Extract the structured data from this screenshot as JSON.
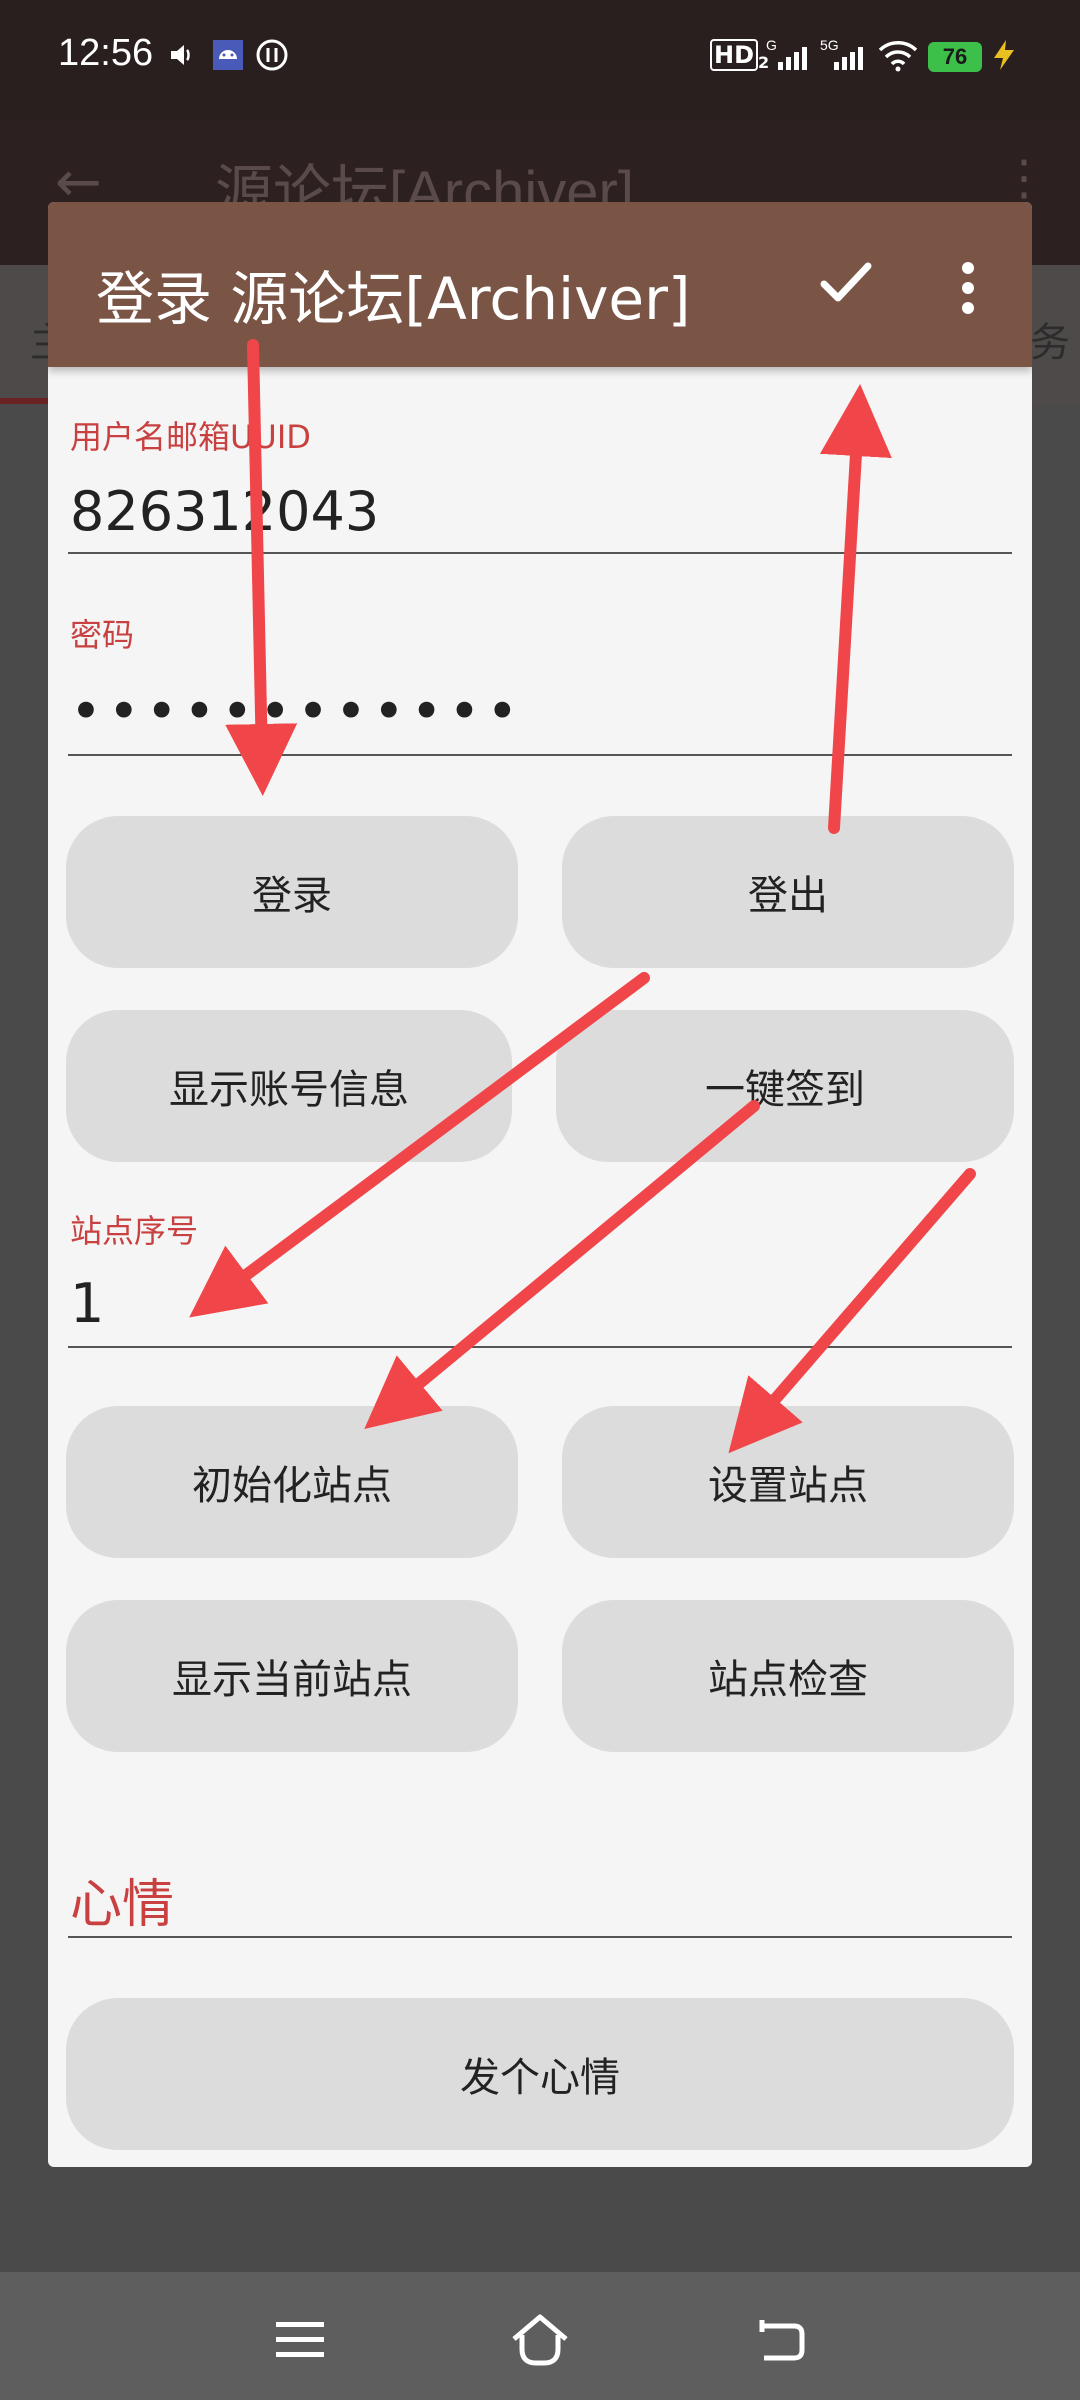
{
  "status_bar": {
    "time": "12:56",
    "battery": "76",
    "icons": [
      "volume-icon",
      "android-notification-icon",
      "sync-icon",
      "hd-icon",
      "signal-g-icon",
      "signal-5g-icon",
      "wifi-icon",
      "battery-icon",
      "charging-icon"
    ],
    "hd_label": "HD",
    "hd_sub": "2",
    "g_label": "G",
    "fiveg_label": "5G"
  },
  "background": {
    "title": "源论坛[Archiver]",
    "tab_left": "主",
    "tab_right": "务"
  },
  "dialog": {
    "title": "登录 源论坛[Archiver]",
    "username_label": "用户名邮箱UUID",
    "username_value": "826312043",
    "password_label": "密码",
    "password_value": "••••••••••••",
    "login_button": "登录",
    "logout_button": "登出",
    "show_account_button": "显示账号信息",
    "one_click_signin_button": "一键签到",
    "site_index_label": "站点序号",
    "site_index_value": "1",
    "init_site_button": "初始化站点",
    "set_site_button": "设置站点",
    "show_current_site_button": "显示当前站点",
    "site_check_button": "站点检查",
    "mood_label": "心情",
    "post_mood_button": "发个心情"
  },
  "colors": {
    "dialog_bar": "#7a5546",
    "accent_label": "#c94040",
    "arrow": "#f0464a",
    "button_bg": "#dcdcdc"
  }
}
